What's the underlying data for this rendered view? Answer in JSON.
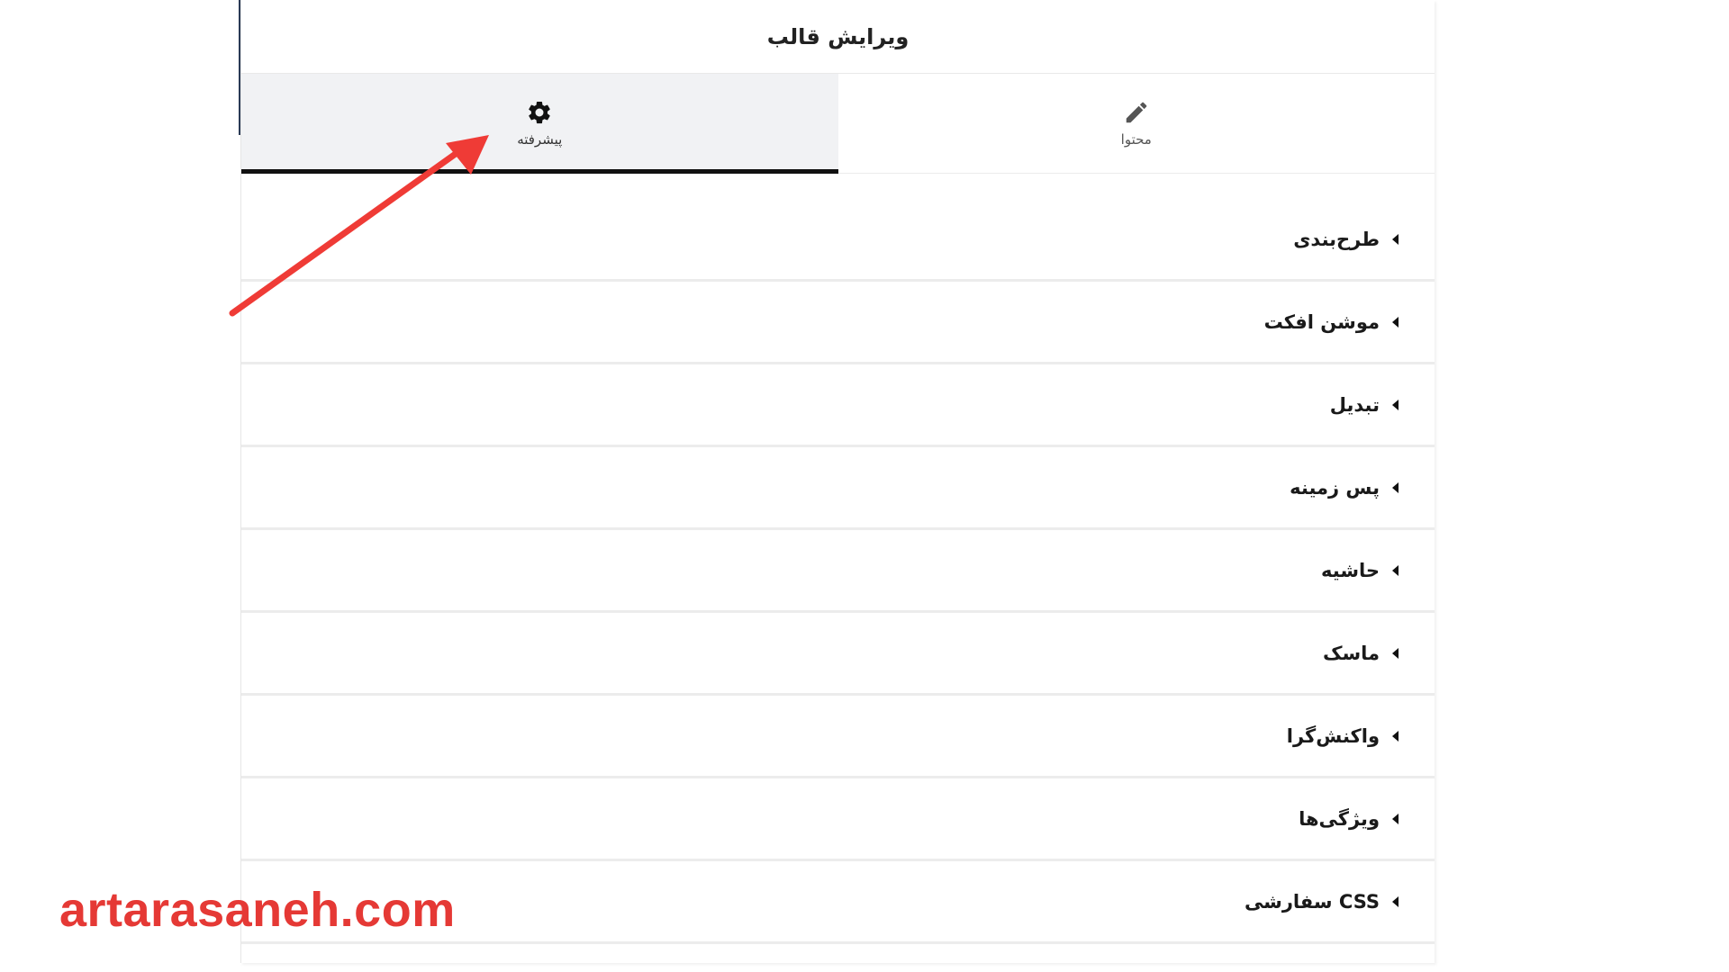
{
  "header": {
    "title": "ویرایش قالب"
  },
  "tabs": [
    {
      "label": "محتوا",
      "icon": "pencil-icon",
      "active": false
    },
    {
      "label": "پیشرفته",
      "icon": "gear-icon",
      "active": true
    }
  ],
  "sections": [
    {
      "label": "طرح‌بندی"
    },
    {
      "label": "موشن افکت"
    },
    {
      "label": "تبدیل"
    },
    {
      "label": "پس زمینه"
    },
    {
      "label": "حاشیه"
    },
    {
      "label": "ماسک"
    },
    {
      "label": "واکنش‌گرا"
    },
    {
      "label": "ویژگی‌ها"
    },
    {
      "label": "CSS سفارشی"
    }
  ],
  "watermark": {
    "text": "artarasaneh.com"
  },
  "colors": {
    "arrow": "#ef3b36",
    "watermark": "#e53935",
    "active_tab_bg": "#f1f2f4",
    "active_tab_underline": "#111111"
  }
}
